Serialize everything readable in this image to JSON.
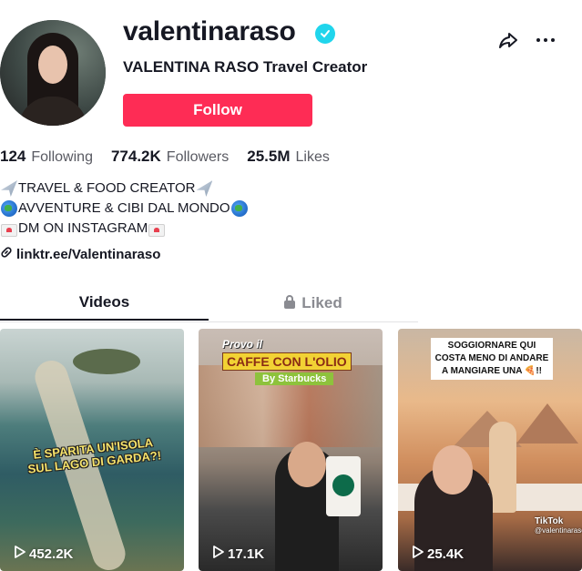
{
  "profile": {
    "username": "valentinaraso",
    "nickname": "VALENTINA RASO Travel Creator",
    "follow_label": "Follow",
    "accent_color": "#fe2c55",
    "verified_color": "#20d5ec"
  },
  "stats": [
    {
      "value": "124",
      "label": "Following"
    },
    {
      "value": "774.2K",
      "label": "Followers"
    },
    {
      "value": "25.5M",
      "label": "Likes"
    }
  ],
  "bio": [
    {
      "icon": "airplane",
      "text": "TRAVEL & FOOD CREATOR"
    },
    {
      "icon": "globe",
      "text": "AVVENTURE & CIBI DAL MONDO"
    },
    {
      "icon": "love-letter",
      "text": "DM ON INSTAGRAM"
    }
  ],
  "link": "linktr.ee/Valentinaraso",
  "tabs": [
    {
      "label": "Videos",
      "active": true
    },
    {
      "label": "Liked",
      "active": false,
      "icon": "lock"
    }
  ],
  "videos": [
    {
      "plays": "452.2K",
      "caption": "È SPARITA UN'ISOLA SUL LAGO DI GARDA?!"
    },
    {
      "plays": "17.1K",
      "caption_top": "Provo il",
      "caption_main": "CAFFE CON L'OLIO",
      "caption_sub": "By Starbucks"
    },
    {
      "plays": "25.4K",
      "caption": "SOGGIORNARE QUI COSTA MENO DI ANDARE A MANGIARE UNA 🍕!!",
      "watermark": "TikTok",
      "watermark_handle": "@valentinaraso"
    }
  ]
}
